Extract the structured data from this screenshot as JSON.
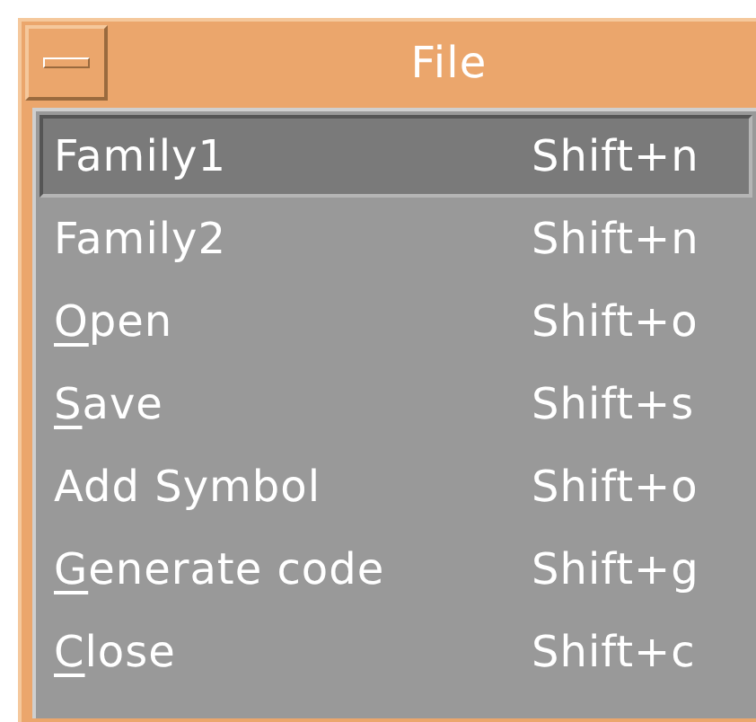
{
  "menu": {
    "title": "File",
    "items": [
      {
        "label": "Family1",
        "shortcut": "Shift+n",
        "selected": true,
        "underlined_first": false
      },
      {
        "label": "Family2",
        "shortcut": "Shift+n",
        "selected": false,
        "underlined_first": false
      },
      {
        "label": "Open",
        "shortcut": "Shift+o",
        "selected": false,
        "underlined_first": true
      },
      {
        "label": "Save",
        "shortcut": "Shift+s",
        "selected": false,
        "underlined_first": true
      },
      {
        "label": "Add Symbol",
        "shortcut": "Shift+o",
        "selected": false,
        "underlined_first": false
      },
      {
        "label": "Generate code",
        "shortcut": "Shift+g",
        "selected": false,
        "underlined_first": true
      },
      {
        "label": "Close",
        "shortcut": "Shift+c",
        "selected": false,
        "underlined_first": true
      }
    ]
  }
}
